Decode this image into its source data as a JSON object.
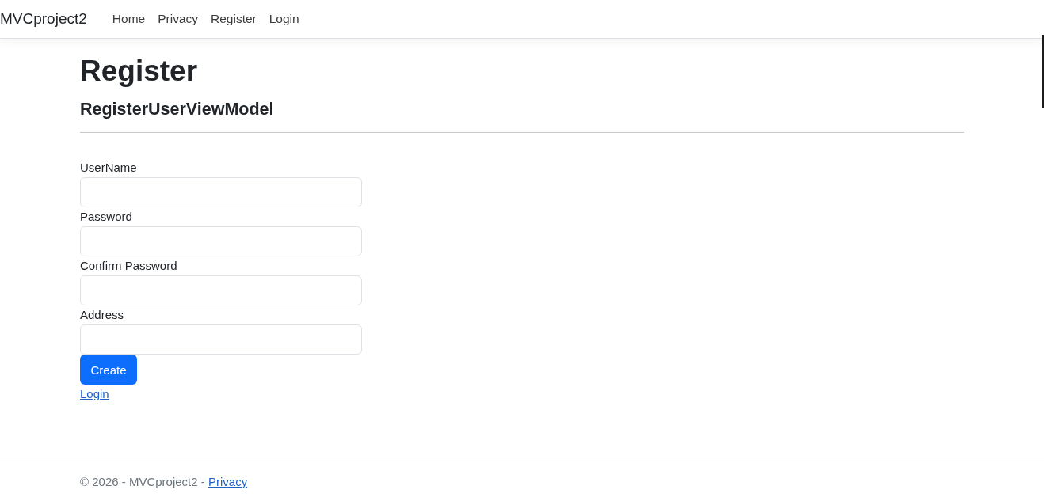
{
  "navbar": {
    "brand": "MVCproject2",
    "links": [
      {
        "label": "Home"
      },
      {
        "label": "Privacy"
      },
      {
        "label": "Register"
      },
      {
        "label": "Login"
      }
    ]
  },
  "page": {
    "title": "Register",
    "subtitle": "RegisterUserViewModel"
  },
  "form": {
    "fields": [
      {
        "label": "UserName"
      },
      {
        "label": "Password"
      },
      {
        "label": "Confirm Password"
      },
      {
        "label": "Address"
      }
    ],
    "submit": "Create",
    "link": "Login"
  },
  "footer": {
    "text": "© 2026 - MVCproject2 -",
    "link": "Privacy"
  }
}
